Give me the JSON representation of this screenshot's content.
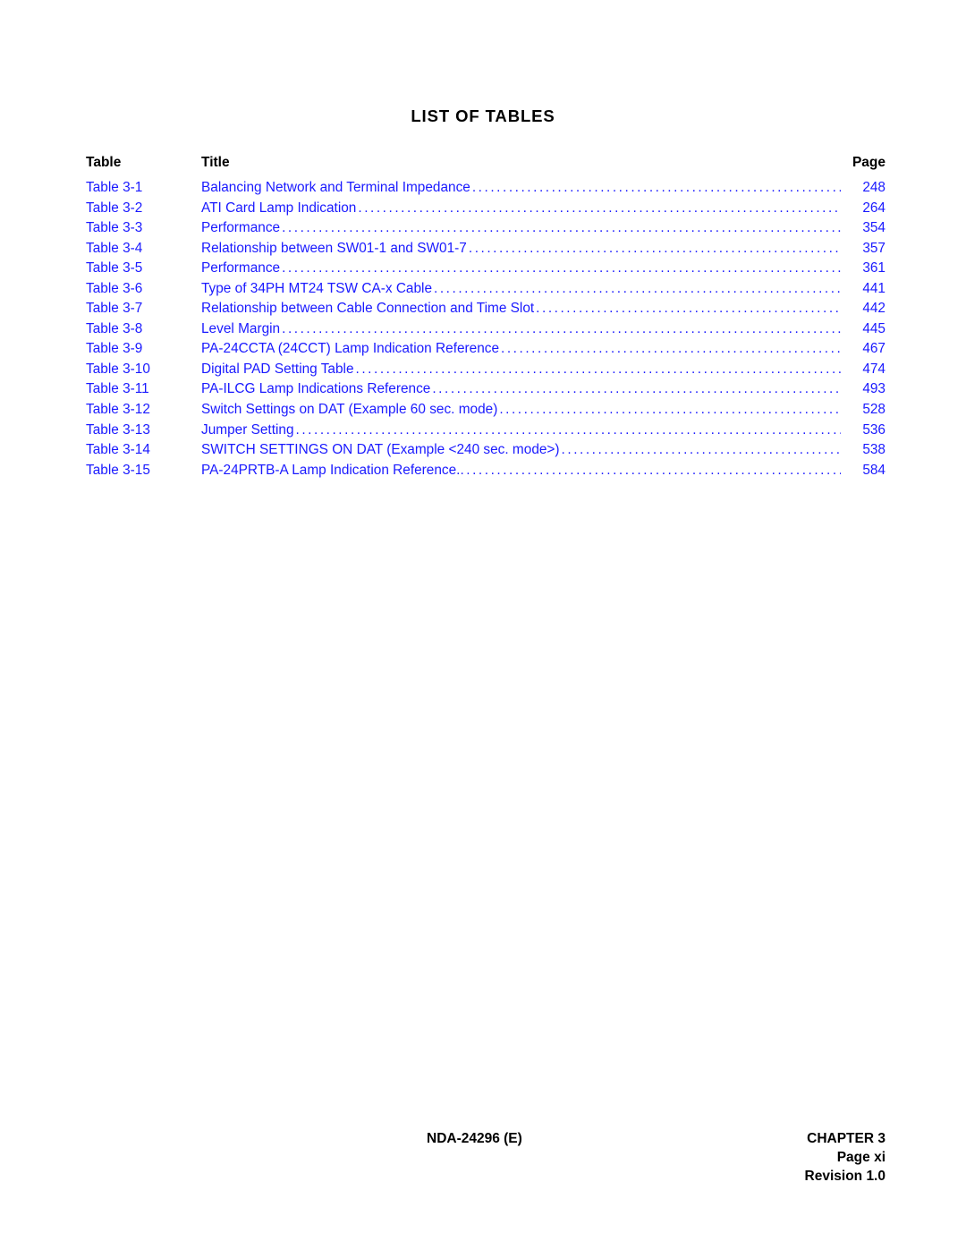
{
  "document": {
    "heading": "LIST OF TABLES"
  },
  "columns": {
    "table": "Table",
    "title": "Title",
    "page": "Page"
  },
  "entries": [
    {
      "label": "Table 3-1",
      "title": "Balancing Network and Terminal Impedance",
      "page": "248"
    },
    {
      "label": "Table 3-2",
      "title": "ATI Card Lamp Indication",
      "page": "264"
    },
    {
      "label": "Table 3-3",
      "title": "Performance",
      "page": "354"
    },
    {
      "label": "Table 3-4",
      "title": "Relationship between SW01-1 and SW01-7",
      "page": "357"
    },
    {
      "label": "Table 3-5",
      "title": "Performance",
      "page": "361"
    },
    {
      "label": "Table 3-6",
      "title": "Type of 34PH MT24 TSW CA-x Cable",
      "page": "441"
    },
    {
      "label": "Table 3-7",
      "title": "Relationship between Cable Connection and Time Slot",
      "page": "442"
    },
    {
      "label": "Table 3-8",
      "title": "Level Margin",
      "page": "445"
    },
    {
      "label": "Table 3-9",
      "title": "PA-24CCTA (24CCT) Lamp Indication Reference",
      "page": "467"
    },
    {
      "label": "Table 3-10",
      "title": "Digital PAD Setting Table",
      "page": "474"
    },
    {
      "label": "Table 3-11",
      "title": "PA-ILCG Lamp Indications Reference",
      "page": "493"
    },
    {
      "label": "Table 3-12",
      "title": "Switch Settings on DAT (Example 60 sec. mode)",
      "page": "528"
    },
    {
      "label": "Table 3-13",
      "title": "Jumper Setting",
      "page": "536"
    },
    {
      "label": "Table 3-14",
      "title": "SWITCH SETTINGS ON DAT (Example <240 sec. mode>)",
      "page": "538"
    },
    {
      "label": "Table 3-15",
      "title": "PA-24PRTB-A Lamp Indication Reference.",
      "page": "584"
    }
  ],
  "footer": {
    "doc_number": "NDA-24296 (E)",
    "chapter": "CHAPTER 3",
    "page_label": "Page xi",
    "revision": "Revision 1.0"
  },
  "colors": {
    "entry_blue": "#1a1aff",
    "text_black": "#000000",
    "background": "#ffffff"
  }
}
